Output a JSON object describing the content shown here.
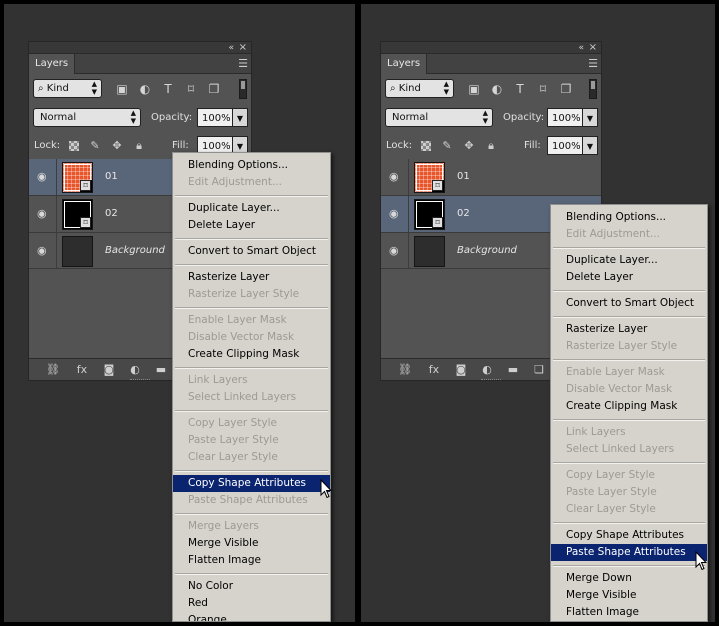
{
  "panel": {
    "tab_title": "Layers",
    "collapse_glyph": "«",
    "close_glyph": "×",
    "menu_glyph": "☰",
    "kind_label": "Kind",
    "blend_mode": "Normal",
    "opacity_label": "Opacity:",
    "opacity_value": "100%",
    "lock_label": "Lock:",
    "fill_label": "Fill:",
    "fill_value": "100%",
    "layers": [
      {
        "name": "01",
        "thumb": "orange-shape"
      },
      {
        "name": "02",
        "thumb": "black-shape"
      },
      {
        "name": "Background",
        "thumb": "dark"
      }
    ],
    "fx_label": "fx"
  },
  "left": {
    "selected_layer": "01",
    "menu_items": [
      {
        "label": "Blending Options...",
        "enabled": true
      },
      {
        "label": "Edit Adjustment...",
        "enabled": false
      },
      {
        "sep": true
      },
      {
        "label": "Duplicate Layer...",
        "enabled": true
      },
      {
        "label": "Delete Layer",
        "enabled": true
      },
      {
        "sep": true
      },
      {
        "label": "Convert to Smart Object",
        "enabled": true
      },
      {
        "sep": true
      },
      {
        "label": "Rasterize Layer",
        "enabled": true
      },
      {
        "label": "Rasterize Layer Style",
        "enabled": false
      },
      {
        "sep": true
      },
      {
        "label": "Enable Layer Mask",
        "enabled": false
      },
      {
        "label": "Disable Vector Mask",
        "enabled": false
      },
      {
        "label": "Create Clipping Mask",
        "enabled": true
      },
      {
        "sep": true
      },
      {
        "label": "Link Layers",
        "enabled": false
      },
      {
        "label": "Select Linked Layers",
        "enabled": false
      },
      {
        "sep": true
      },
      {
        "label": "Copy Layer Style",
        "enabled": false
      },
      {
        "label": "Paste Layer Style",
        "enabled": false
      },
      {
        "label": "Clear Layer Style",
        "enabled": false
      },
      {
        "sep": true
      },
      {
        "label": "Copy Shape Attributes",
        "enabled": true,
        "highlighted": true
      },
      {
        "label": "Paste Shape Attributes",
        "enabled": false
      },
      {
        "sep": true
      },
      {
        "label": "Merge Layers",
        "enabled": false
      },
      {
        "label": "Merge Visible",
        "enabled": true
      },
      {
        "label": "Flatten Image",
        "enabled": true
      },
      {
        "sep": true
      },
      {
        "label": "No Color",
        "enabled": true
      },
      {
        "label": "Red",
        "enabled": true
      },
      {
        "label": "Orange",
        "enabled": true
      }
    ]
  },
  "right": {
    "selected_layer": "02",
    "menu_items": [
      {
        "label": "Blending Options...",
        "enabled": true
      },
      {
        "label": "Edit Adjustment...",
        "enabled": false
      },
      {
        "sep": true
      },
      {
        "label": "Duplicate Layer...",
        "enabled": true
      },
      {
        "label": "Delete Layer",
        "enabled": true
      },
      {
        "sep": true
      },
      {
        "label": "Convert to Smart Object",
        "enabled": true
      },
      {
        "sep": true
      },
      {
        "label": "Rasterize Layer",
        "enabled": true
      },
      {
        "label": "Rasterize Layer Style",
        "enabled": false
      },
      {
        "sep": true
      },
      {
        "label": "Enable Layer Mask",
        "enabled": false
      },
      {
        "label": "Disable Vector Mask",
        "enabled": false
      },
      {
        "label": "Create Clipping Mask",
        "enabled": true
      },
      {
        "sep": true
      },
      {
        "label": "Link Layers",
        "enabled": false
      },
      {
        "label": "Select Linked Layers",
        "enabled": false
      },
      {
        "sep": true
      },
      {
        "label": "Copy Layer Style",
        "enabled": false
      },
      {
        "label": "Paste Layer Style",
        "enabled": false
      },
      {
        "label": "Clear Layer Style",
        "enabled": false
      },
      {
        "sep": true
      },
      {
        "label": "Copy Shape Attributes",
        "enabled": true
      },
      {
        "label": "Paste Shape Attributes",
        "enabled": true,
        "highlighted": true
      },
      {
        "sep": true
      },
      {
        "label": "Merge Down",
        "enabled": true
      },
      {
        "label": "Merge Visible",
        "enabled": true
      },
      {
        "label": "Flatten Image",
        "enabled": true
      }
    ]
  },
  "colors": {
    "menu_bg": "#d6d3cc",
    "menu_highlight": "#0b2470",
    "selected_layer": "#596679",
    "panel_bg": "#535353",
    "workspace_bg": "#323232"
  }
}
